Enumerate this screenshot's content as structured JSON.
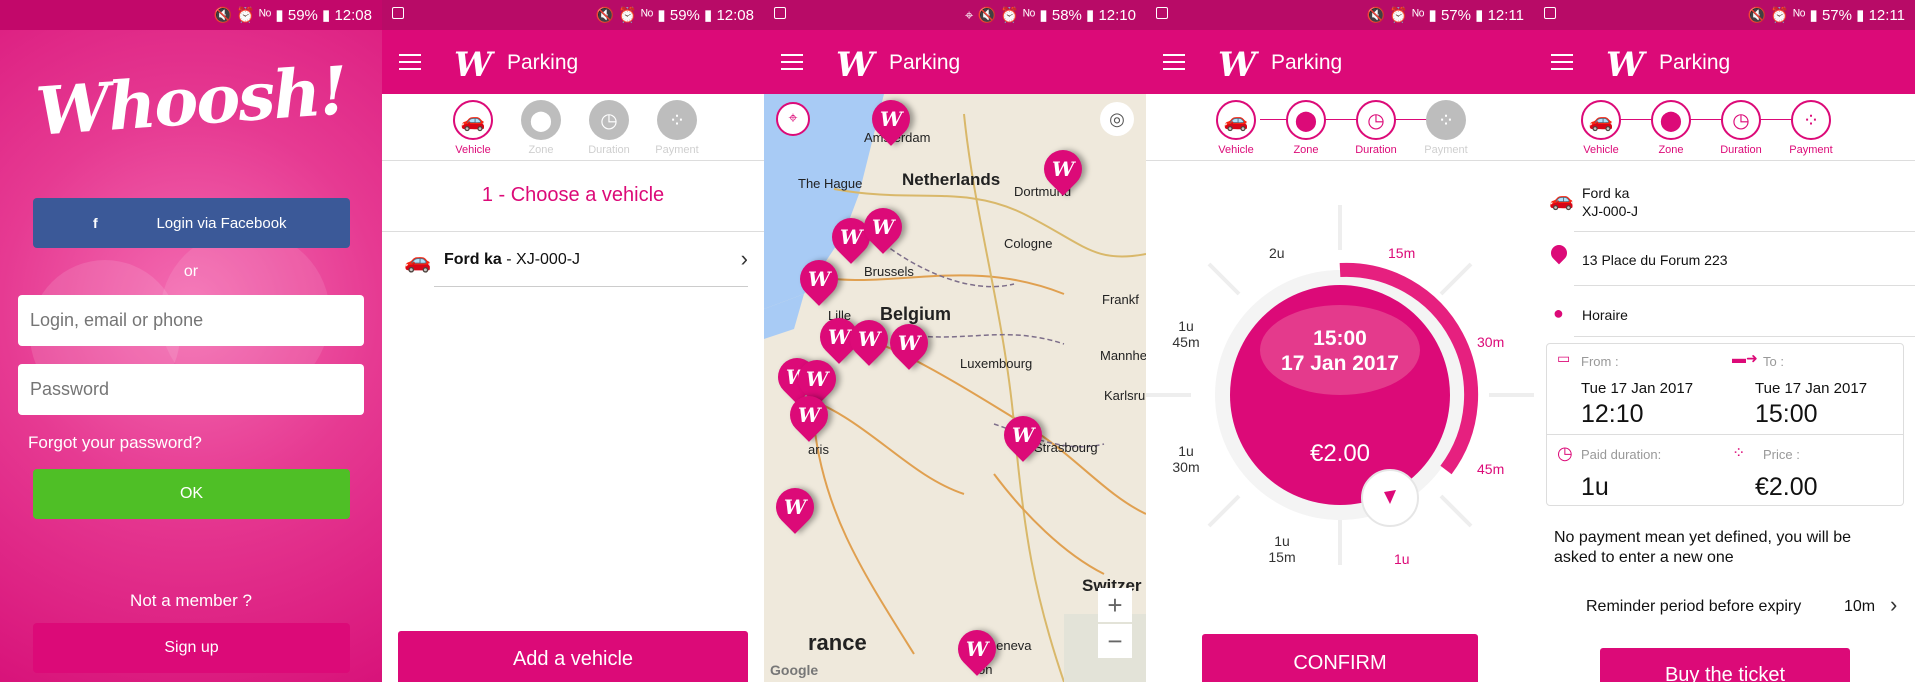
{
  "status": [
    {
      "text": "🔇 ⏰ ᴺᵒ ▮ 59% ▮ 12:08"
    },
    {
      "text": "🔇 ⏰ ᴺᵒ ▮ 59% ▮ 12:08"
    },
    {
      "text": "⌖ 🔇 ⏰ ᴺᵒ ▮ 58% ▮ 12:10"
    },
    {
      "text": "🔇 ⏰ ᴺᵒ ▮ 57% ▮ 12:11"
    },
    {
      "text": "🔇 ⏰ ᴺᵒ ▮ 57% ▮ 12:11"
    }
  ],
  "login": {
    "logo": "Whoosh!",
    "facebook_icon": "f",
    "facebook_label": "Login via Facebook",
    "or": "or",
    "login_placeholder": "Login, email or phone",
    "password_placeholder": "Password",
    "forgot": "Forgot your password?",
    "ok": "OK",
    "not_member": "Not a member ?",
    "signup": "Sign up"
  },
  "appbar": {
    "logo": "W",
    "title": "Parking"
  },
  "steps": {
    "vehicle": "Vehicle",
    "zone": "Zone",
    "duration": "Duration",
    "payment": "Payment"
  },
  "vehicle": {
    "heading": "1 - Choose a vehicle",
    "name": "Ford ka",
    "plate": " - XJ-000-J",
    "add_button": "Add a vehicle"
  },
  "map": {
    "places": [
      "Amsterdam",
      "The Hague",
      "Netherlands",
      "Dortmund",
      "Cologne",
      "Brussels",
      "Lille",
      "Belgium",
      "Frankf",
      "Luxembourg",
      "Mannhe",
      "Karlsru",
      "aris",
      "Strasbourg",
      "Switzer",
      "rance",
      "Geneva",
      "on"
    ],
    "google": "Google",
    "zoom_in": "+",
    "zoom_out": "−"
  },
  "duration": {
    "labels": [
      "2u",
      "15m",
      "30m",
      "45m",
      "1u",
      "1u\n15m",
      "1u\n30m",
      "1u\n45m"
    ],
    "time": "15:00",
    "date": "17 Jan 2017",
    "price": "€2.00",
    "confirm": "CONFIRM"
  },
  "summary": {
    "vehicle_name": "Ford ka",
    "vehicle_plate": "XJ-000-J",
    "zone": "13 Place du Forum 223",
    "mode": "Horaire",
    "from_label": "From :",
    "from_date": "Tue 17 Jan 2017",
    "from_time": "12:10",
    "to_label": "To :",
    "to_date": "Tue 17 Jan 2017",
    "to_time": "15:00",
    "paid_label": "Paid duration:",
    "paid_value": "1u",
    "price_label": "Price :",
    "price_value": "€2.00",
    "payment_note": "No payment mean yet defined, you will be asked to enter a new one",
    "reminder_label": "Reminder period before expiry",
    "reminder_value": "10m",
    "buy": "Buy the ticket"
  },
  "colors": {
    "brand": "#dc0a78",
    "facebook": "#3b5998",
    "ok": "#4fbf26"
  }
}
